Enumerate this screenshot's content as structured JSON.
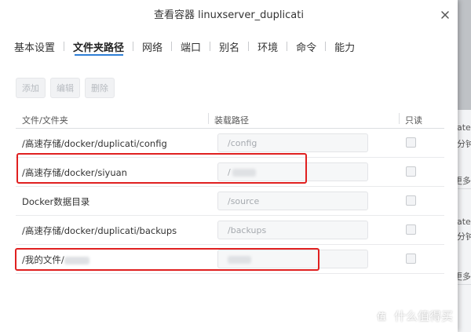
{
  "dialog": {
    "title": "查看容器 linuxserver_duplicati",
    "close_icon": "close-icon"
  },
  "tabs": [
    {
      "label": "基本设置",
      "active": false
    },
    {
      "label": "文件夹路径",
      "active": true
    },
    {
      "label": "网络",
      "active": false
    },
    {
      "label": "端口",
      "active": false
    },
    {
      "label": "别名",
      "active": false
    },
    {
      "label": "环境",
      "active": false
    },
    {
      "label": "命令",
      "active": false
    },
    {
      "label": "能力",
      "active": false
    }
  ],
  "toolbar": {
    "add_label": "添加",
    "edit_label": "编辑",
    "delete_label": "删除"
  },
  "table": {
    "headers": {
      "folder": "文件/文件夹",
      "mount": "装载路径",
      "readonly": "只读"
    },
    "rows": [
      {
        "folder": "/高速存储/docker/duplicati/config",
        "mount": "/config",
        "readonly": false
      },
      {
        "folder": "/高速存储/docker/siyuan",
        "mount": "/",
        "readonly": false
      },
      {
        "folder": "Docker数据目录",
        "mount": "/source",
        "readonly": false
      },
      {
        "folder": "/高速存储/docker/duplicati/backups",
        "mount": "/backups",
        "readonly": false
      },
      {
        "folder": "/我的文件/",
        "mount": "",
        "readonly": false
      }
    ]
  },
  "background": {
    "fragments": [
      "ates",
      "分钟",
      "更多",
      "ates",
      "分钟",
      "更多"
    ]
  },
  "watermark": {
    "logo": "值",
    "text": "什么值得买"
  },
  "colors": {
    "accent": "#2f7fd6",
    "highlight": "#e02020"
  }
}
